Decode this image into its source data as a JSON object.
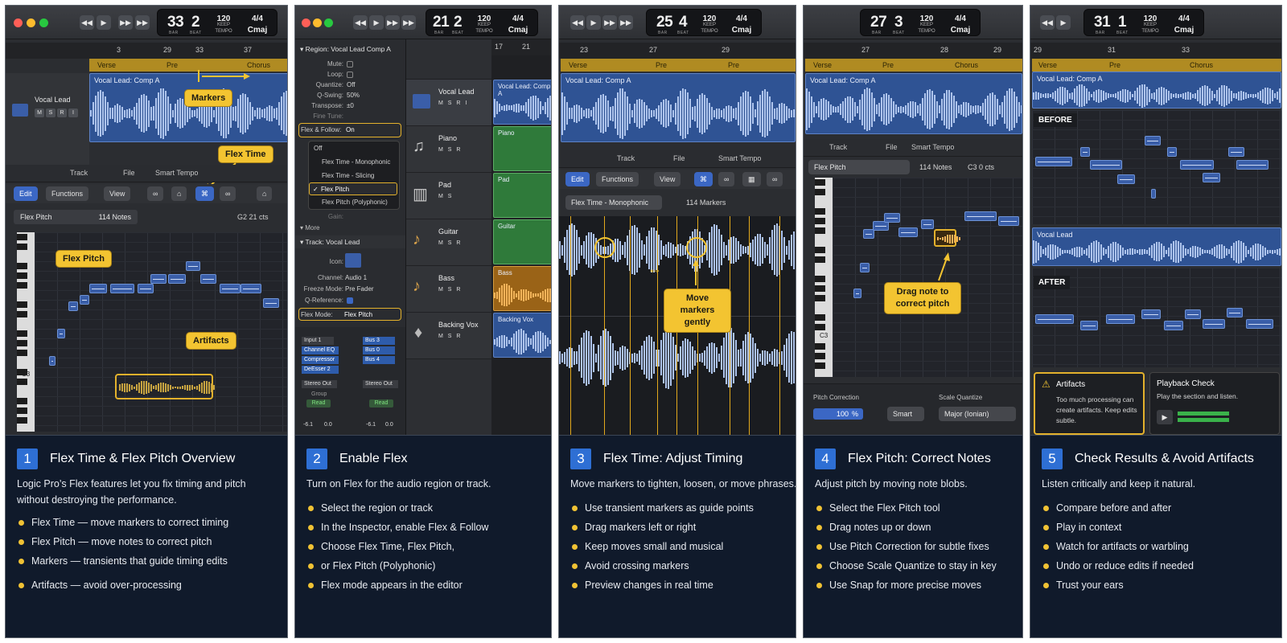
{
  "transport_labels": {
    "bar": "BAR",
    "beat": "BEAT",
    "keep": "KEEP",
    "tempo": "TEMPO"
  },
  "panels": [
    {
      "transport": {
        "bar": "33",
        "beat": "2",
        "tempo": "120",
        "sig": "4/4",
        "key": "Cmaj"
      },
      "ruler": [
        "3",
        "29",
        "33",
        "37"
      ],
      "arrangement": [
        "Verse",
        "Pre",
        "Chorus"
      ],
      "track_name": "Vocal Lead",
      "region_name": "Vocal Lead: Comp A",
      "msi": [
        "M",
        "S",
        "R",
        "I"
      ],
      "tabs": [
        "Track",
        "File",
        "Smart Tempo"
      ],
      "toolbar": [
        "Edit",
        "Functions",
        "View"
      ],
      "mode": "Flex Pitch",
      "notes_count": "114 Notes",
      "pitch_readout": "G2  21 cts",
      "c3": "C3",
      "callouts": {
        "markers": "Markers",
        "flex_time": "Flex Time",
        "flex_pitch": "Flex Pitch",
        "artifacts": "Artifacts"
      },
      "desc": {
        "num": "1",
        "title": "Flex Time & Flex Pitch Overview",
        "sub": "Logic Pro’s Flex features let you fix timing and pitch without destroying the performance.",
        "bullets": [
          "Flex Time  —  move markers to correct timing",
          "Flex Pitch  —  move notes to correct pitch",
          "Markers   —  transients that guide timing edits",
          "Artifacts  —  avoid over-processing"
        ]
      }
    },
    {
      "transport": {
        "bar": "21",
        "beat": "2",
        "tempo": "120",
        "sig": "4/4",
        "key": "Cmaj"
      },
      "ruler": [
        "17",
        "21"
      ],
      "region_header": "Region: Vocal Lead Comp A",
      "inspector": [
        {
          "k": "Mute:",
          "v": ""
        },
        {
          "k": "Loop:",
          "v": ""
        },
        {
          "k": "Quantize:",
          "v": "Off"
        },
        {
          "k": "Q-Swing:",
          "v": "50%"
        },
        {
          "k": "Transpose:",
          "v": "±0"
        },
        {
          "k": "Fine Tune:",
          "v": ""
        }
      ],
      "flex_follow": {
        "label": "Flex & Follow:",
        "value": "On"
      },
      "flex_menu": [
        "Off",
        "Flex Time - Monophonic",
        "Flex Time - Slicing",
        "Flex Pitch",
        "Flex Pitch (Polyphonic)"
      ],
      "gain": "Gain:",
      "more": "More",
      "track_header": "Track: Vocal Lead",
      "track_inspector": [
        {
          "k": "Icon:",
          "v": ""
        },
        {
          "k": "Channel:",
          "v": "Audio 1"
        },
        {
          "k": "Freeze Mode:",
          "v": "Pre Fader"
        },
        {
          "k": "Q-Reference:",
          "v": ""
        }
      ],
      "flex_mode": {
        "label": "Flex Mode:",
        "value": "Flex Pitch"
      },
      "strip_left": [
        "Input 1",
        "Channel EQ",
        "Compressor",
        "DeEsser 2",
        "Stereo Out",
        "Group",
        "Read",
        "-6.1",
        "0.0"
      ],
      "strip_right": [
        "Bus 3",
        "Bus 0",
        "Bus 4",
        "Stereo Out",
        "Read",
        "-6.1",
        "0.0"
      ],
      "tracks": [
        {
          "name": "Vocal Lead",
          "msi": "M S R I",
          "region": "Vocal Lead: Comp A"
        },
        {
          "name": "Piano",
          "msi": "M S R",
          "region": "Piano"
        },
        {
          "name": "Pad",
          "msi": "M S",
          "region": "Pad"
        },
        {
          "name": "Guitar",
          "msi": "M S R",
          "region": "Guitar"
        },
        {
          "name": "Bass",
          "msi": "M S R",
          "region": "Bass"
        },
        {
          "name": "Backing Vox",
          "msi": "M S R",
          "region": "Backing Vox"
        }
      ],
      "desc": {
        "num": "2",
        "title": "Enable Flex",
        "sub": "Turn on Flex for the audio region or track.",
        "bullets": [
          "Select the region or track",
          "In the Inspector, enable Flex & Follow",
          "Choose Flex Time, Flex Pitch,",
          "Flex mode appears in the editor"
        ],
        "bullet3_cont": "or Flex Pitch (Polyphonic)"
      }
    },
    {
      "transport": {
        "bar": "25",
        "beat": "4",
        "tempo": "120",
        "sig": "4/4",
        "key": "Cmaj"
      },
      "ruler": [
        "23",
        "27",
        "29"
      ],
      "arrangement": [
        "Verse",
        "Pre"
      ],
      "region_name": "Vocal Lead: Comp A",
      "tabs": [
        "Track",
        "File",
        "Smart Tempo"
      ],
      "toolbar": [
        "Edit",
        "Functions",
        "View"
      ],
      "mode": "Flex Time - Monophonic",
      "markers_count": "114 Markers",
      "callout": "Move markers gently",
      "desc": {
        "num": "3",
        "title": "Flex Time: Adjust Timing",
        "sub": "Move markers to tighten, loosen, or move phrases.",
        "bullets": [
          "Use transient markers as guide points",
          "Drag markers left or right",
          "Keep moves small and musical",
          "Avoid crossing markers",
          "Preview changes in real time"
        ]
      }
    },
    {
      "transport": {
        "bar": "27",
        "beat": "3",
        "tempo": "120",
        "sig": "4/4",
        "key": "Cmaj"
      },
      "ruler": [
        "27",
        "28",
        "29"
      ],
      "arrangement": [
        "Verse",
        "Pre",
        "Chorus"
      ],
      "region_name": "Vocal Lead: Comp A",
      "tabs": [
        "Track",
        "File",
        "Smart Tempo"
      ],
      "mode": "Flex Pitch",
      "notes_count": "114 Notes",
      "pitch_readout": "C3  0 cts",
      "c3": "C3",
      "callout": "Drag note to correct pitch",
      "pitch_correction": {
        "label": "Pitch Correction",
        "value": "100",
        "unit": "%",
        "mode": "Smart"
      },
      "scale_quantize": {
        "label": "Scale Quantize",
        "value": "Major (Ionian)"
      },
      "desc": {
        "num": "4",
        "title": "Flex Pitch: Correct Notes",
        "sub": "Adjust pitch by moving note blobs.",
        "bullets": [
          "Select the Flex Pitch tool",
          "Drag notes up or down",
          "Use Pitch Correction for subtle fixes",
          "Choose Scale Quantize to stay in key",
          "Use Snap for more precise moves"
        ]
      }
    },
    {
      "transport": {
        "bar": "31",
        "beat": "1",
        "tempo": "120",
        "sig": "4/4",
        "key": "Cmaj"
      },
      "ruler": [
        "29",
        "31",
        "33"
      ],
      "arrangement": [
        "Verse",
        "Pre",
        "Chorus"
      ],
      "region_name": "Vocal Lead: Comp A",
      "before": "BEFORE",
      "region2_name": "Vocal Lead",
      "after": "AFTER",
      "artifacts_card": {
        "title": "Artifacts",
        "body": "Too much processing can create artifacts. Keep edits subtle."
      },
      "playback_card": {
        "title": "Playback Check",
        "body": "Play the section and listen."
      },
      "desc": {
        "num": "5",
        "title": "Check Results & Avoid Artifacts",
        "sub": "Listen critically and keep it natural.",
        "bullets": [
          "Compare before and after",
          "Play in context",
          "Watch for artifacts or warbling",
          "Undo or reduce edits if needed",
          "Trust your ears"
        ]
      }
    }
  ]
}
